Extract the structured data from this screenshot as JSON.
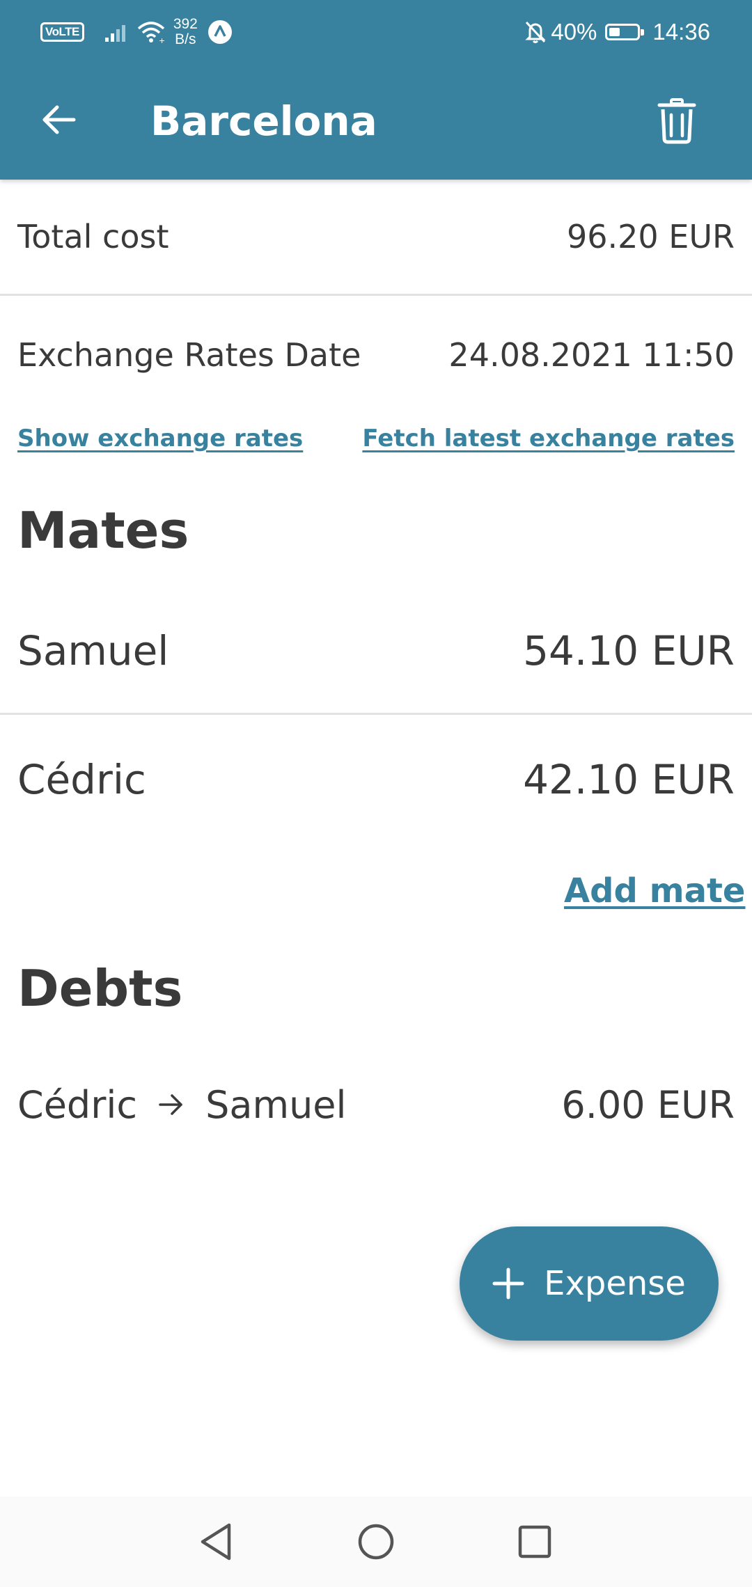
{
  "status_bar": {
    "volte": "VoLTE",
    "net_speed_value": "392",
    "net_speed_unit": "B/s",
    "battery_percent": "40%",
    "battery_level": 0.4,
    "time": "14:36"
  },
  "toolbar": {
    "title": "Barcelona",
    "back_icon": "arrow-left-icon",
    "delete_icon": "trash-icon"
  },
  "summary": {
    "total_cost_label": "Total cost",
    "total_cost_value": "96.20 EUR",
    "exchange_rates_date_label": "Exchange Rates Date",
    "exchange_rates_date_value": "24.08.2021 11:50",
    "show_rates_link": "Show exchange rates",
    "fetch_rates_link": "Fetch latest exchange rates"
  },
  "mates": {
    "title": "Mates",
    "items": [
      {
        "name": "Samuel",
        "amount": "54.10 EUR"
      },
      {
        "name": "Cédric",
        "amount": "42.10 EUR"
      }
    ],
    "add_link": "Add mate"
  },
  "debts": {
    "title": "Debts",
    "items": [
      {
        "from": "Cédric",
        "to": "Samuel",
        "amount": "6.00 EUR"
      }
    ]
  },
  "fab": {
    "label": "Expense",
    "icon": "plus-icon"
  },
  "colors": {
    "primary": "#38829f",
    "text": "#3a3a3a",
    "divider": "#e2e2e2",
    "background": "#ffffff"
  }
}
